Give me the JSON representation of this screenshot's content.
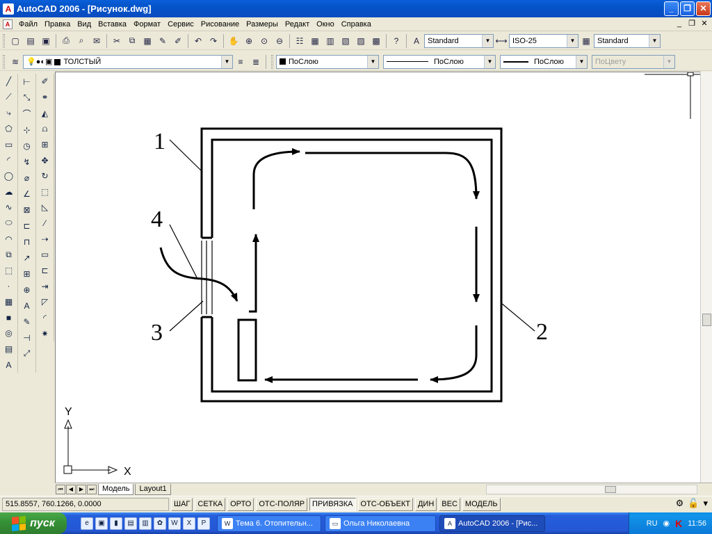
{
  "window": {
    "title": "AutoCAD 2006 - [Рисунок.dwg]",
    "min": "_",
    "max": "❐",
    "close": "✕"
  },
  "menu": [
    "Файл",
    "Правка",
    "Вид",
    "Вставка",
    "Формат",
    "Сервис",
    "Рисование",
    "Размеры",
    "Редакт",
    "Окно",
    "Справка"
  ],
  "std_toolbar": {
    "text_style": "Standard",
    "dim_style": "ISO-25",
    "table_style": "Standard"
  },
  "layers_toolbar": {
    "layer_name": "ТОЛСТЫЙ",
    "color": "ПоСлою",
    "linetype": "ПоСлою",
    "lineweight": "ПоСлою",
    "plotstyle": "ПоЦвету"
  },
  "drawing": {
    "labels": [
      "1",
      "2",
      "3",
      "4"
    ],
    "ucs_y": "Y",
    "ucs_x": "X"
  },
  "tabs": [
    "Модель",
    "Layout1"
  ],
  "status": {
    "coords": "515.8557, 760.1266, 0.0000",
    "buttons": [
      "ШАГ",
      "СЕТКА",
      "ОРТО",
      "ОТС-ПОЛЯР",
      "ПРИВЯЗКА",
      "ОТС-ОБЪЕКТ",
      "ДИН",
      "ВЕС",
      "МОДЕЛЬ"
    ],
    "on_button": "ПРИВЯЗКА"
  },
  "taskbar": {
    "start": "пуск",
    "tasks": [
      "Тема 6. Отопительн...",
      "Ольга Николаевна",
      "AutoCAD 2006 - [Рис..."
    ],
    "lang": "RU",
    "clock": "11:56"
  },
  "colors": {
    "titlebar": "#0453c8",
    "taskbar": "#245edb",
    "start": "#379337"
  }
}
